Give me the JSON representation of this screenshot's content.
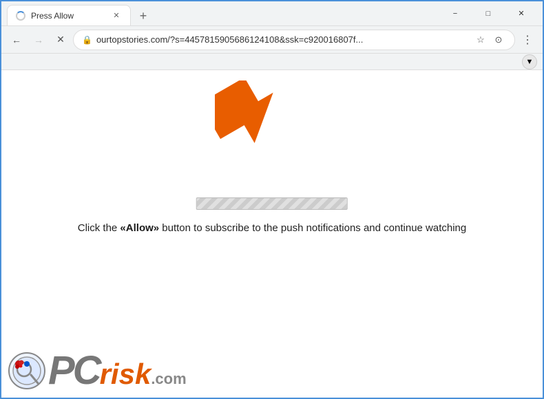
{
  "window": {
    "title": "Press Allow",
    "minimize_label": "−",
    "maximize_label": "□",
    "close_label": "✕"
  },
  "tab": {
    "title": "Press Allow",
    "close_label": "✕"
  },
  "new_tab_btn": "+",
  "nav": {
    "back_label": "←",
    "forward_label": "→",
    "reload_label": "✕",
    "address": "ourtopstories.com/?s=4457815905686124108&ssk=c920016807f...",
    "bookmark_icon": "☆",
    "profile_icon": "⊙",
    "menu_icon": "⋮",
    "download_icon": "⬇"
  },
  "page": {
    "main_text": "Click the «Allow» button to subscribe to the push notifications and continue watching",
    "allow_word": "«Allow»"
  },
  "pcrisk": {
    "pc": "PC",
    "risk": "risk",
    "dotcom": ".com"
  }
}
